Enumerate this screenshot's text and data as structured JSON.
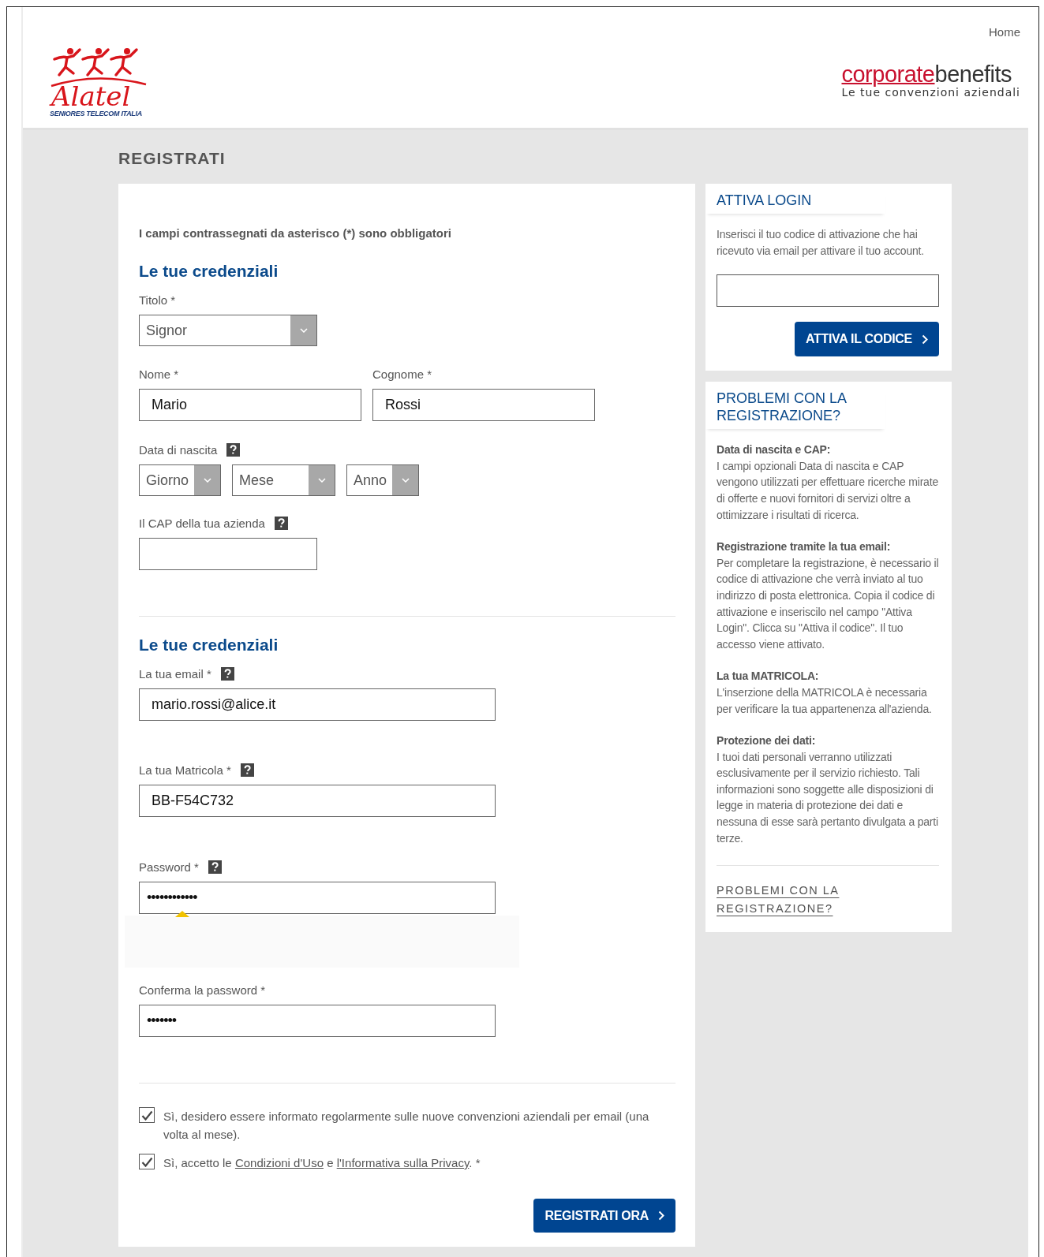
{
  "header": {
    "home_link": "Home",
    "logo_left": {
      "name": "Alatel",
      "tagline": "SENIORES TELECOM ITALIA"
    },
    "logo_right": {
      "brand_first": "corporate",
      "brand_second": "benefits",
      "tagline": "Le tue convenzioni aziendali"
    }
  },
  "page_title": "REGISTRATI",
  "form": {
    "required_note": "I campi contrassegnati da asterisco (*) sono obbligatori",
    "sections": [
      {
        "heading": "Le tue credenziali",
        "rows": [
          {
            "fields": [
              {
                "kind": "select",
                "label": "Titolo *",
                "value": "Signor"
              }
            ]
          },
          {
            "fields": [
              {
                "kind": "text",
                "label": "Nome *",
                "value": "Mario"
              },
              {
                "kind": "text",
                "label": "Cognome *",
                "value": "Rossi"
              }
            ]
          },
          {
            "fields": [
              {
                "kind": "date",
                "label": "Data di nascita",
                "help": true,
                "selects": [
                  "Giorno",
                  "Mese",
                  "Anno"
                ]
              }
            ]
          },
          {
            "fields": [
              {
                "kind": "text",
                "label": "Il CAP della tua azienda",
                "help": true
              }
            ]
          }
        ]
      },
      {
        "heading": "Le tue credenziali",
        "rows": [
          {
            "fields": [
              {
                "kind": "text",
                "label": "La tua email *",
                "help": true,
                "value": "mario.rossi@alice.it"
              }
            ]
          },
          {
            "fields": [
              {
                "kind": "text",
                "label": "La tua Matricola *",
                "help": true,
                "value": "BB-F54C732"
              }
            ]
          },
          {
            "fields": [
              {
                "kind": "password",
                "label": "Password *",
                "help": true,
                "value": "••••••••••••"
              }
            ]
          },
          {
            "fields": [
              {
                "kind": "password",
                "label": "Conferma la password *",
                "value": "•••••••"
              }
            ]
          }
        ]
      }
    ],
    "consents": [
      {
        "checked": true,
        "segments": [
          {
            "kind": "text",
            "text": "Sì, desidero essere informato regolarmente sulle nuove convenzioni aziendali per email (una volta al mese)."
          }
        ]
      },
      {
        "checked": true,
        "segments": [
          {
            "kind": "text",
            "text": "Sì, accetto le "
          },
          {
            "kind": "link",
            "text": "Condizioni d'Uso"
          },
          {
            "kind": "text",
            "text": " e "
          },
          {
            "kind": "link",
            "text": "l'Informativa sulla Privacy"
          },
          {
            "kind": "text",
            "text": ". *"
          }
        ]
      }
    ],
    "submit": "REGISTRATI ORA"
  },
  "sidebar": {
    "activate": {
      "title": "ATTIVA LOGIN",
      "text": "Inserisci il tuo codice di attivazione che hai ricevuto via email per attivare il tuo account.",
      "button": "ATTIVA IL CODICE"
    },
    "help": {
      "title": "PROBLEMI CON LA REGISTRAZIONE?",
      "topics": [
        {
          "title": "Data di nascita e CAP:",
          "body": "I campi opzionali Data di nascita e CAP vengono utilizzati per effettuare ricerche mirate di offerte e nuovi fornitori di servizi oltre a ottimizzare i risultati di ricerca."
        },
        {
          "title": "Registrazione tramite la tua email:",
          "body": "Per completare la registrazione, è necessario il codice di attivazione che verrà inviato al tuo indirizzo di posta elettronica. Copia il codice di attivazione e inseriscilo nel campo \"Attiva Login\". Clicca su \"Attiva il codice\". Il tuo accesso viene attivato."
        },
        {
          "title": "La tua MATRICOLA:",
          "body": "L'inserzione della MATRICOLA è necessaria per verificare la tua appartenenza all'azienda."
        },
        {
          "title": "Protezione dei dati:",
          "body": "I tuoi dati personali verranno utilizzati esclusivamente per il servizio richiesto. Tali informazioni sono soggette alle disposizioni di legge in materia di protezione dei dati e nessuna di esse sarà pertanto divulgata a parti terze."
        }
      ],
      "link": "PROBLEMI CON LA REGISTRAZIONE?"
    }
  }
}
